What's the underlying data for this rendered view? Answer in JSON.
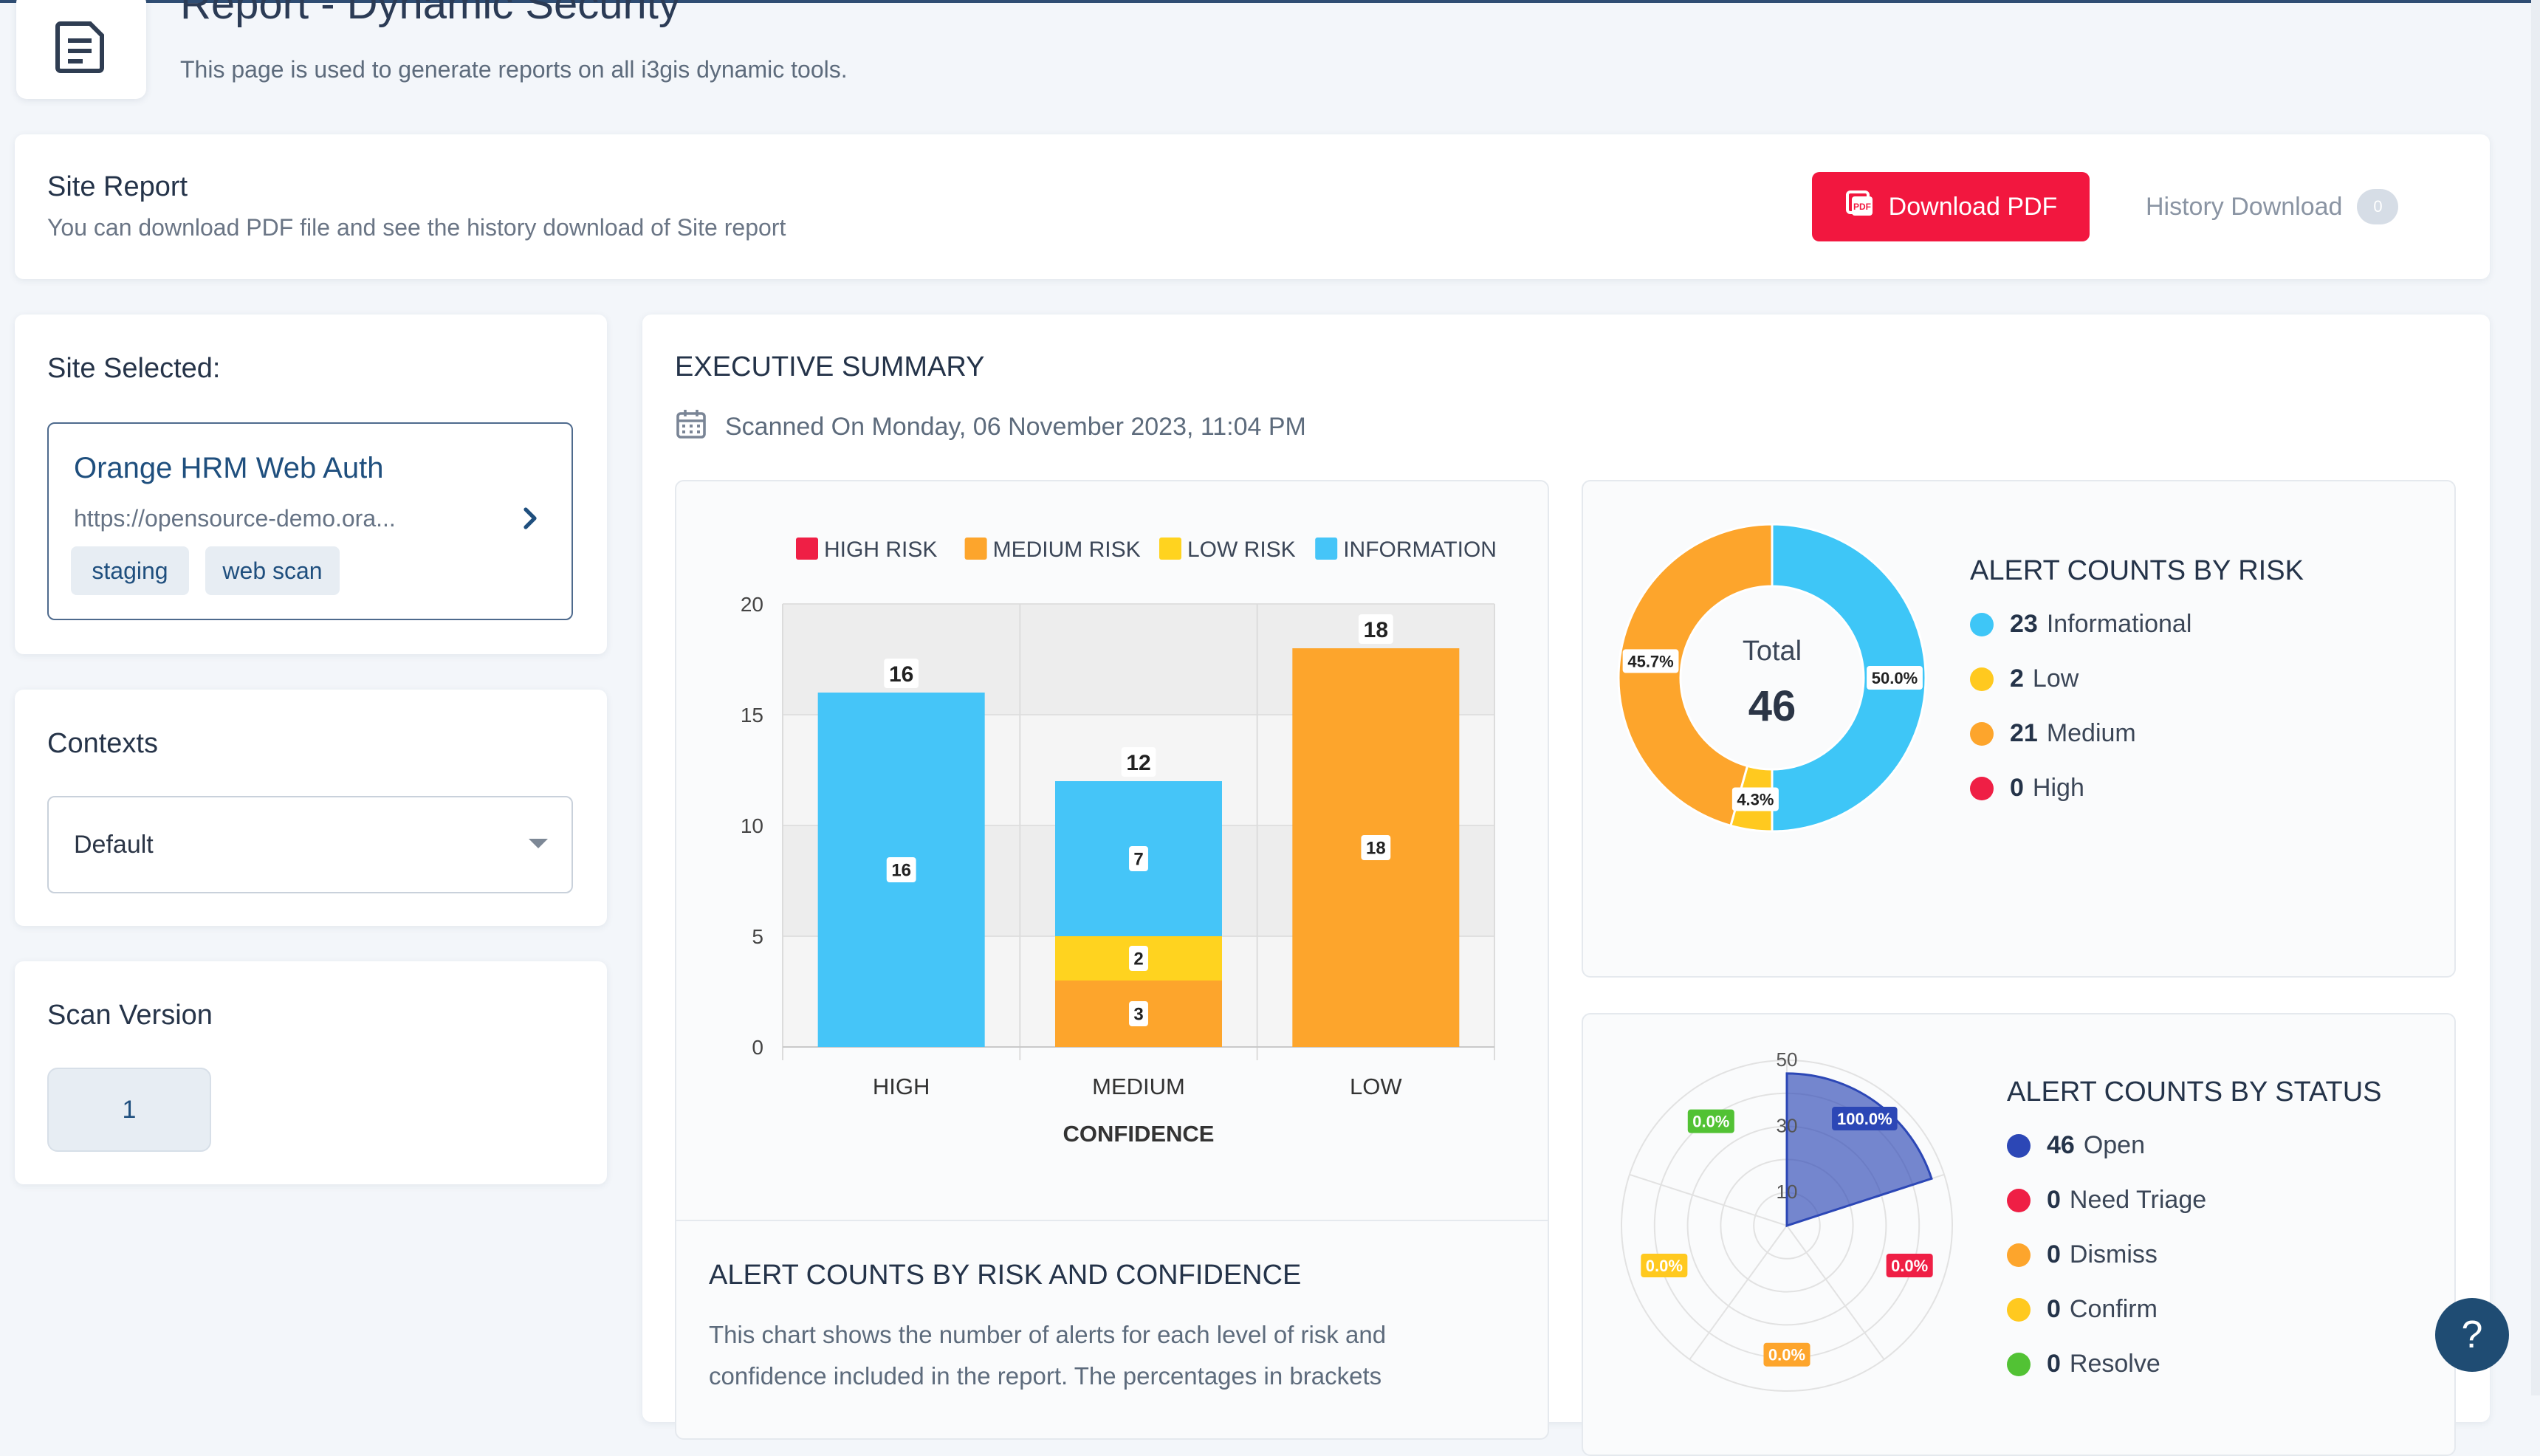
{
  "header": {
    "title": "Report - Dynamic Security",
    "subtitle": "This page is used to generate reports on all i3gis dynamic tools."
  },
  "site_report": {
    "title": "Site Report",
    "subtitle": "You can download PDF file and see the history download of Site report",
    "download_label": "Download PDF",
    "history_label": "History Download",
    "history_count": "0"
  },
  "site_selected": {
    "label": "Site Selected:",
    "name": "Orange HRM Web Auth",
    "url": "https://opensource-demo.ora...",
    "tags": [
      "staging",
      "web scan"
    ]
  },
  "contexts": {
    "label": "Contexts",
    "value": "Default"
  },
  "scan_version": {
    "label": "Scan Version",
    "value": "1"
  },
  "executive": {
    "title": "EXECUTIVE SUMMARY",
    "scanned": "Scanned On Monday, 06 November 2023, 11:04 PM"
  },
  "risk_counts": {
    "title": "ALERT COUNTS BY RISK",
    "total_label": "Total",
    "total": "46",
    "items": [
      {
        "count": "23",
        "label": "Informational",
        "color": "#3ec6f7"
      },
      {
        "count": "2",
        "label": "Low",
        "color": "#ffc91f"
      },
      {
        "count": "21",
        "label": "Medium",
        "color": "#fda52c"
      },
      {
        "count": "0",
        "label": "High",
        "color": "#ef1f45"
      }
    ]
  },
  "status_counts": {
    "title": "ALERT COUNTS BY STATUS",
    "items": [
      {
        "count": "46",
        "label": "Open",
        "color": "#2c47b6"
      },
      {
        "count": "0",
        "label": "Need Triage",
        "color": "#ef1f45"
      },
      {
        "count": "0",
        "label": "Dismiss",
        "color": "#fda52c"
      },
      {
        "count": "0",
        "label": "Confirm",
        "color": "#ffc91f"
      },
      {
        "count": "0",
        "label": "Resolve",
        "color": "#52c234"
      }
    ]
  },
  "risk_confidence": {
    "title": "ALERT COUNTS BY RISK AND CONFIDENCE",
    "description": "This chart shows the number of alerts for each level of risk and confidence included in the report. The percentages in brackets"
  },
  "help_label": "?",
  "chart_data": [
    {
      "type": "bar",
      "stacked": true,
      "categories": [
        "HIGH",
        "MEDIUM",
        "LOW"
      ],
      "xlabel": "CONFIDENCE",
      "ylim": [
        0,
        20
      ],
      "yticks": [
        "0",
        "5",
        "10",
        "15",
        "20"
      ],
      "legend_position": "top",
      "series": [
        {
          "name": "HIGH RISK",
          "color": "#ef1f45",
          "values": [
            0,
            0,
            0
          ]
        },
        {
          "name": "MEDIUM RISK",
          "color": "#fda52c",
          "values": [
            0,
            3,
            18
          ]
        },
        {
          "name": "LOW RISK",
          "color": "#ffd31f",
          "values": [
            0,
            2,
            0
          ]
        },
        {
          "name": "INFORMATION",
          "color": "#45c5f8",
          "values": [
            16,
            7,
            0
          ]
        }
      ],
      "totals": [
        16,
        12,
        18
      ]
    },
    {
      "type": "pie",
      "donut": true,
      "values": [
        23,
        2,
        21,
        0
      ],
      "labels": [
        "Informational",
        "Low",
        "Medium",
        "High"
      ],
      "percent_labels": [
        "50.0%",
        "4.3%",
        "45.7%",
        ""
      ],
      "colors": [
        "#3ec6f7",
        "#ffc91f",
        "#fda52c",
        "#ef1f45"
      ]
    },
    {
      "type": "polar-area",
      "ticks": [
        "10",
        "30",
        "50"
      ],
      "rmax": 50,
      "values": [
        46,
        0,
        0,
        0,
        0
      ],
      "labels": [
        "Open",
        "Need Triage",
        "Dismiss",
        "Confirm",
        "Resolve"
      ],
      "percent_labels": [
        "100.0%",
        "0.0%",
        "0.0%",
        "0.0%",
        "0.0%"
      ],
      "label_colors": [
        "#2c47b6",
        "#ef1f45",
        "#fda52c",
        "#ffc91f",
        "#52c234"
      ]
    }
  ]
}
